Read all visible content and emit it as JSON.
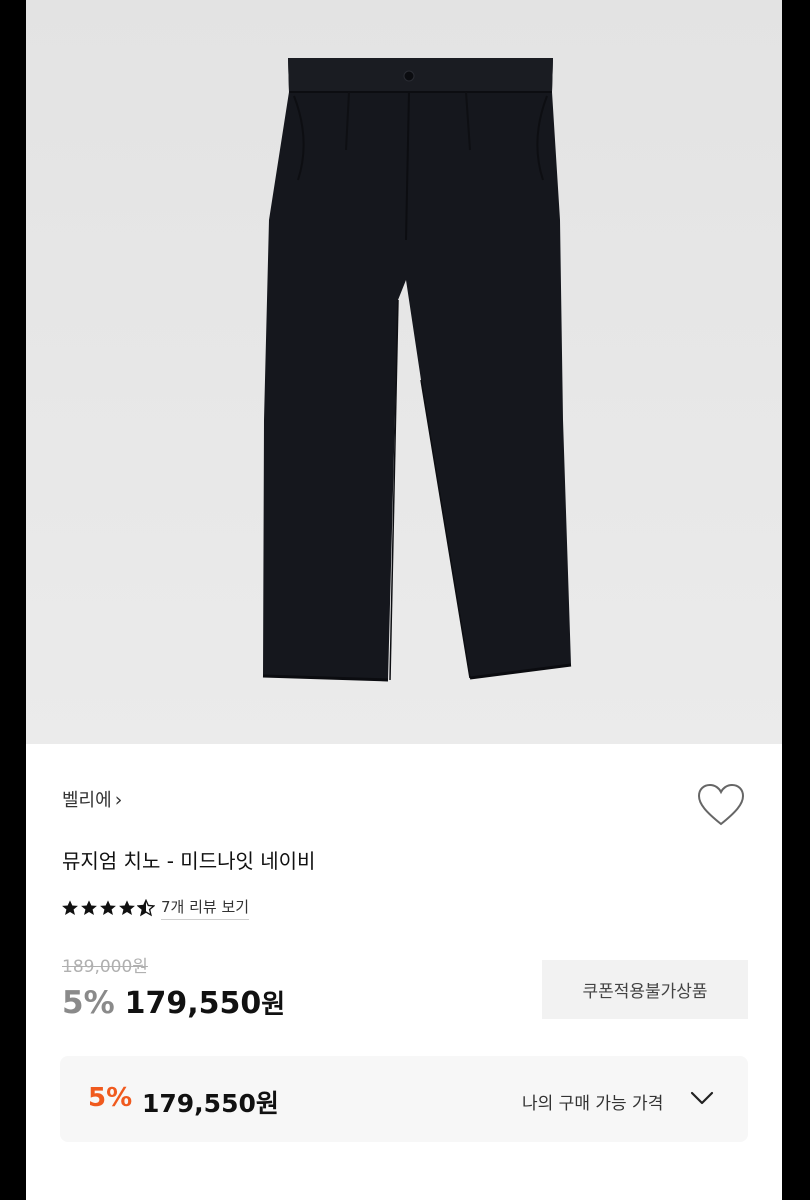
{
  "product": {
    "brand": "벨리에",
    "name": "뮤지엄 치노 - 미드나잇 네이비",
    "image_icon": "navy-pleated-trousers",
    "rating_stars": 4.5,
    "review_link": "7개 리뷰 보기",
    "original_price": "189,000원",
    "sale_rate": "5%",
    "sale_price": "179,550",
    "currency": "원",
    "coupon_notice": "쿠폰적용불가상품"
  },
  "my_price": {
    "rate": "5%",
    "price": "179,550원",
    "label": "나의 구매 가능 가격"
  },
  "colors": {
    "accent_orange": "#f05a1e",
    "pants_navy": "#14161c",
    "image_bg": "#e6e6e6"
  }
}
